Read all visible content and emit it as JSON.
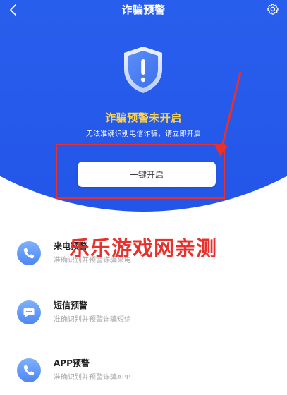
{
  "header": {
    "title": "诈骗预警",
    "back_icon": "chevron-left-icon",
    "settings_icon": "gear-icon"
  },
  "status": {
    "icon": "shield-exclamation-icon",
    "title": "诈骗预警未开启",
    "subtitle": "无法准确识别电信诈骗，请立即开启"
  },
  "enable_button": {
    "label": "一键开启"
  },
  "watermark": "乐乐游戏网亲测",
  "features": [
    {
      "icon": "phone-icon",
      "title": "来电预警",
      "subtitle": "准确识别并预警诈骗来电"
    },
    {
      "icon": "message-icon",
      "title": "短信预警",
      "subtitle": "准确识别并预警诈骗短信"
    },
    {
      "icon": "phone-icon",
      "title": "APP预警",
      "subtitle": "准确识别并预警诈骗APP"
    }
  ],
  "colors": {
    "primary_blue": "#2a60ee",
    "warning_yellow": "#ffd54a",
    "annotation_red": "#e8302c"
  }
}
